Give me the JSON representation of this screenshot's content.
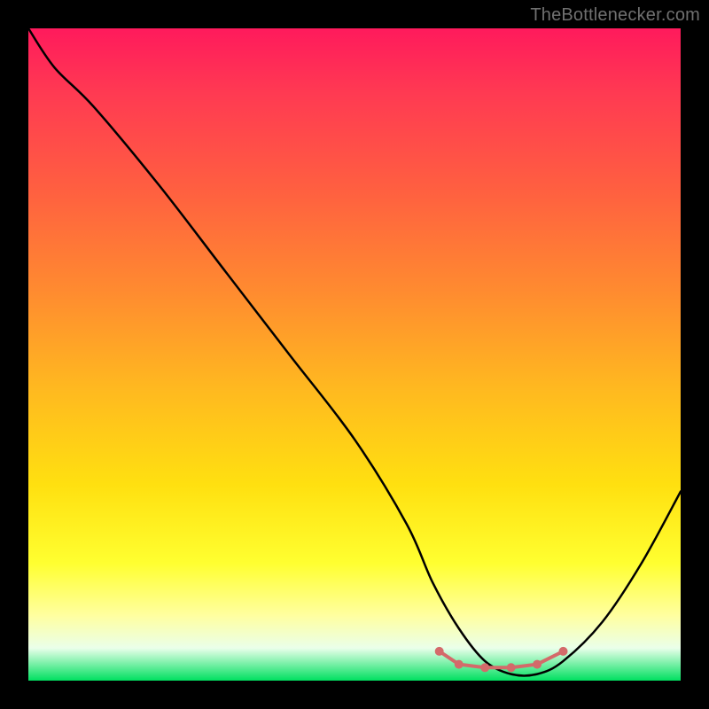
{
  "watermark": "TheBottlenecker.com",
  "chart_data": {
    "type": "line",
    "title": "",
    "xlabel": "",
    "ylabel": "",
    "xlim": [
      0,
      100
    ],
    "ylim": [
      0,
      100
    ],
    "series": [
      {
        "name": "bottleneck-curve",
        "x": [
          0,
          4,
          10,
          20,
          30,
          40,
          50,
          58,
          62,
          66,
          70,
          74,
          78,
          82,
          88,
          94,
          100
        ],
        "y": [
          100,
          94,
          88,
          76,
          63,
          50,
          37,
          24,
          15,
          8,
          3,
          1,
          1,
          3,
          9,
          18,
          29
        ]
      }
    ],
    "markers": {
      "name": "min-band-dots",
      "x": [
        63,
        66,
        70,
        74,
        78,
        82
      ],
      "y": [
        4.5,
        2.5,
        2,
        2,
        2.5,
        4.5
      ]
    },
    "background": {
      "type": "vertical-gradient",
      "stops": [
        {
          "pct": 0,
          "color": "#ff1a5c"
        },
        {
          "pct": 25,
          "color": "#ff6040"
        },
        {
          "pct": 55,
          "color": "#ffb820"
        },
        {
          "pct": 82,
          "color": "#ffff30"
        },
        {
          "pct": 95,
          "color": "#eaffea"
        },
        {
          "pct": 100,
          "color": "#00e060"
        }
      ]
    }
  }
}
